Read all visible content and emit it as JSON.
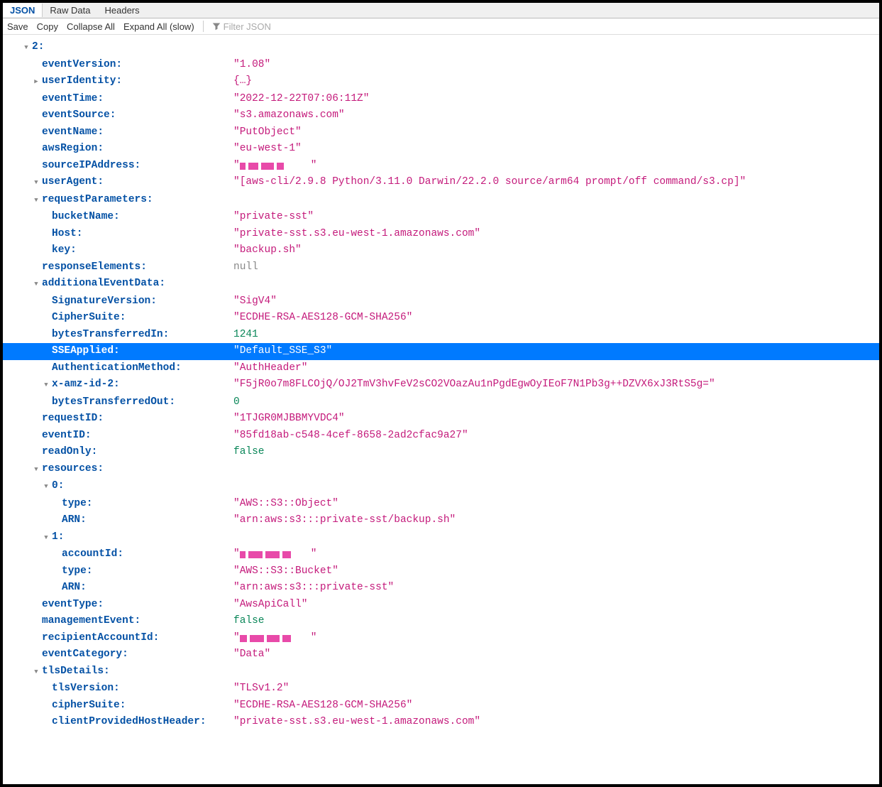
{
  "tabs": {
    "json": "JSON",
    "raw": "Raw Data",
    "headers": "Headers"
  },
  "toolbar": {
    "save": "Save",
    "copy": "Copy",
    "collapse": "Collapse All",
    "expand": "Expand All (slow)",
    "filter_placeholder": "Filter JSON"
  },
  "d": {
    "root_index": "2:",
    "eventVersion_k": "eventVersion:",
    "eventVersion_v": "\"1.08\"",
    "userIdentity_k": "userIdentity:",
    "userIdentity_v": "{…}",
    "eventTime_k": "eventTime:",
    "eventTime_v": "\"2022-12-22T07:06:11Z\"",
    "eventSource_k": "eventSource:",
    "eventSource_v": "\"s3.amazonaws.com\"",
    "eventName_k": "eventName:",
    "eventName_v": "\"PutObject\"",
    "awsRegion_k": "awsRegion:",
    "awsRegion_v": "\"eu-west-1\"",
    "sourceIPAddress_k": "sourceIPAddress:",
    "userAgent_k": "userAgent:",
    "userAgent_v": "\"[aws-cli/2.9.8 Python/3.11.0 Darwin/22.2.0 source/arm64 prompt/off command/s3.cp]\"",
    "requestParameters_k": "requestParameters:",
    "bucketName_k": "bucketName:",
    "bucketName_v": "\"private-sst\"",
    "Host_k": "Host:",
    "Host_v": "\"private-sst.s3.eu-west-1.amazonaws.com\"",
    "key_k": "key:",
    "key_v": "\"backup.sh\"",
    "responseElements_k": "responseElements:",
    "responseElements_v": "null",
    "additionalEventData_k": "additionalEventData:",
    "SignatureVersion_k": "SignatureVersion:",
    "SignatureVersion_v": "\"SigV4\"",
    "CipherSuite_k": "CipherSuite:",
    "CipherSuite_v": "\"ECDHE-RSA-AES128-GCM-SHA256\"",
    "bytesTransferredIn_k": "bytesTransferredIn:",
    "bytesTransferredIn_v": "1241",
    "SSEApplied_k": "SSEApplied:",
    "SSEApplied_v": "\"Default_SSE_S3\"",
    "AuthenticationMethod_k": "AuthenticationMethod:",
    "AuthenticationMethod_v": "\"AuthHeader\"",
    "xamzid2_k": "x-amz-id-2:",
    "xamzid2_v": "\"F5jR0o7m8FLCOjQ/OJ2TmV3hvFeV2sCO2VOazAu1nPgdEgwOyIEoF7N1Pb3g++DZVX6xJ3RtS5g=\"",
    "bytesTransferredOut_k": "bytesTransferredOut:",
    "bytesTransferredOut_v": "0",
    "requestID_k": "requestID:",
    "requestID_v": "\"1TJGR0MJBBMYVDC4\"",
    "eventID_k": "eventID:",
    "eventID_v": "\"85fd18ab-c548-4cef-8658-2ad2cfac9a27\"",
    "readOnly_k": "readOnly:",
    "readOnly_v": "false",
    "resources_k": "resources:",
    "res0_k": "0:",
    "res0_type_k": "type:",
    "res0_type_v": "\"AWS::S3::Object\"",
    "res0_ARN_k": "ARN:",
    "res0_ARN_v": "\"arn:aws:s3:::private-sst/backup.sh\"",
    "res1_k": "1:",
    "res1_accountId_k": "accountId:",
    "res1_type_k": "type:",
    "res1_type_v": "\"AWS::S3::Bucket\"",
    "res1_ARN_k": "ARN:",
    "res1_ARN_v": "\"arn:aws:s3:::private-sst\"",
    "eventType_k": "eventType:",
    "eventType_v": "\"AwsApiCall\"",
    "managementEvent_k": "managementEvent:",
    "managementEvent_v": "false",
    "recipientAccountId_k": "recipientAccountId:",
    "eventCategory_k": "eventCategory:",
    "eventCategory_v": "\"Data\"",
    "tlsDetails_k": "tlsDetails:",
    "tlsVersion_k": "tlsVersion:",
    "tlsVersion_v": "\"TLSv1.2\"",
    "cipherSuite_k": "cipherSuite:",
    "cipherSuite_v": "\"ECDHE-RSA-AES128-GCM-SHA256\"",
    "clientProvidedHostHeader_k": "clientProvidedHostHeader:",
    "clientProvidedHostHeader_v": "\"private-sst.s3.eu-west-1.amazonaws.com\""
  }
}
